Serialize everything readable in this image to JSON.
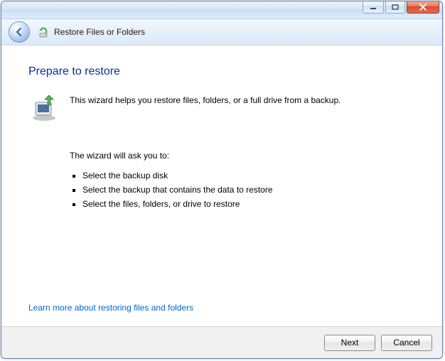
{
  "window": {
    "title": "Restore Files or Folders"
  },
  "page": {
    "heading": "Prepare to restore",
    "intro": "This wizard helps you restore files, folders, or a full drive from a backup.",
    "ask_label": "The wizard will ask you to:",
    "steps": [
      "Select the backup disk",
      "Select the backup that contains the data to restore",
      "Select the files, folders, or drive to restore"
    ],
    "help_link": "Learn more about restoring files and folders"
  },
  "footer": {
    "next": "Next",
    "cancel": "Cancel"
  }
}
